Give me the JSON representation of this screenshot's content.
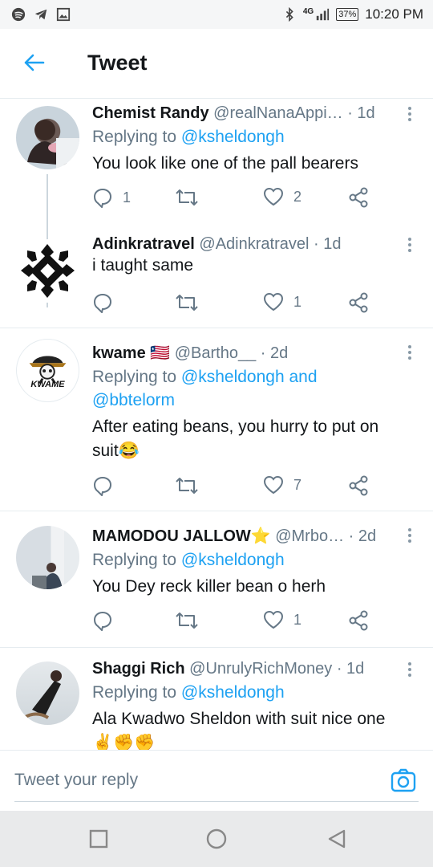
{
  "status": {
    "time": "10:20 PM",
    "battery": "37%",
    "network": "4G",
    "icons": [
      "spotify-icon",
      "telegram-icon",
      "gallery-icon",
      "bluetooth-icon",
      "signal-icon",
      "battery-icon"
    ]
  },
  "header": {
    "title": "Tweet"
  },
  "tweets": [
    {
      "name": "Chemist Randy",
      "handle": "@realNanaAppi…",
      "time": "· 1d",
      "replying_prefix": "Replying to ",
      "replying": "@ksheldongh",
      "text": "You look like one of the pall bearers",
      "replies": "1",
      "retweets": "",
      "likes": "2"
    },
    {
      "name": "Adinkratravel",
      "handle": "@Adinkratravel",
      "time": "· 1d",
      "text": "i taught same",
      "replies": "",
      "retweets": "",
      "likes": "1"
    },
    {
      "name": "kwame 🇱🇷",
      "handle": "@Bartho__",
      "time": "· 2d",
      "replying_prefix": "Replying to ",
      "replying": "@ksheldongh and",
      "replying_line2": "@bbtelorm",
      "text_line1": "After eating beans, you hurry to put on",
      "text_line2": "suit😂",
      "replies": "",
      "retweets": "",
      "likes": "7",
      "avatar_label": "KWAME"
    },
    {
      "name": "MAMODOU JALLOW⭐",
      "handle": "@Mrbo…",
      "time": "· 2d",
      "replying_prefix": "Replying to ",
      "replying": "@ksheldongh",
      "text": "You Dey reck killer bean o herh",
      "replies": "",
      "retweets": "",
      "likes": "1"
    },
    {
      "name": "Shaggi Rich",
      "handle": "@UnrulyRichMoney",
      "time": "· 1d",
      "replying_prefix": "Replying to ",
      "replying": "@ksheldongh",
      "text": "Ala Kwadwo Sheldon with suit nice one",
      "text_line2": "✌️✊✊"
    }
  ],
  "composer": {
    "placeholder": "Tweet your reply"
  },
  "colors": {
    "accent": "#1da1f2",
    "muted": "#657786",
    "divider": "#e6ecf0"
  }
}
